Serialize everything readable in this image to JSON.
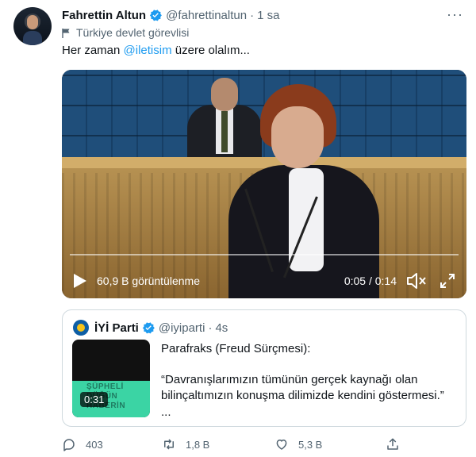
{
  "tweet": {
    "display_name": "Fahrettin Altun",
    "handle": "@fahrettinaltun",
    "separator": "·",
    "time": "1 sa",
    "label": "Türkiye devlet görevlisi",
    "text_prefix": "Her zaman ",
    "mention": "@iletisim",
    "text_suffix": " üzere olalım...",
    "more_label": "···"
  },
  "video": {
    "views": "60,9 B görüntülenme",
    "duration": "0:05 / 0:14"
  },
  "quote": {
    "display_name": "İYİ Parti",
    "handle": "@iyiparti",
    "separator": "·",
    "time": "4s",
    "thumbnail_text": [
      "ŞÜPHELİ",
      "DÜĞÜN",
      "HABERİN"
    ],
    "thumbnail_duration": "0:31",
    "title": "Parafraks (Freud Sürçmesi):",
    "body": "“Davranışlarımızın tümünün gerçek kaynağı olan bilinçaltımızın konuşma dilimizde kendini göstermesi.”",
    "ellipsis": "..."
  },
  "actions": {
    "reply_count": "403",
    "retweet_count": "1,8 B",
    "like_count": "5,3 B",
    "icons": [
      "reply-icon",
      "retweet-icon",
      "like-icon",
      "share-icon"
    ]
  },
  "colors": {
    "accent": "#1d9bf0",
    "secondary_text": "#536471",
    "border": "#cfd9de"
  }
}
